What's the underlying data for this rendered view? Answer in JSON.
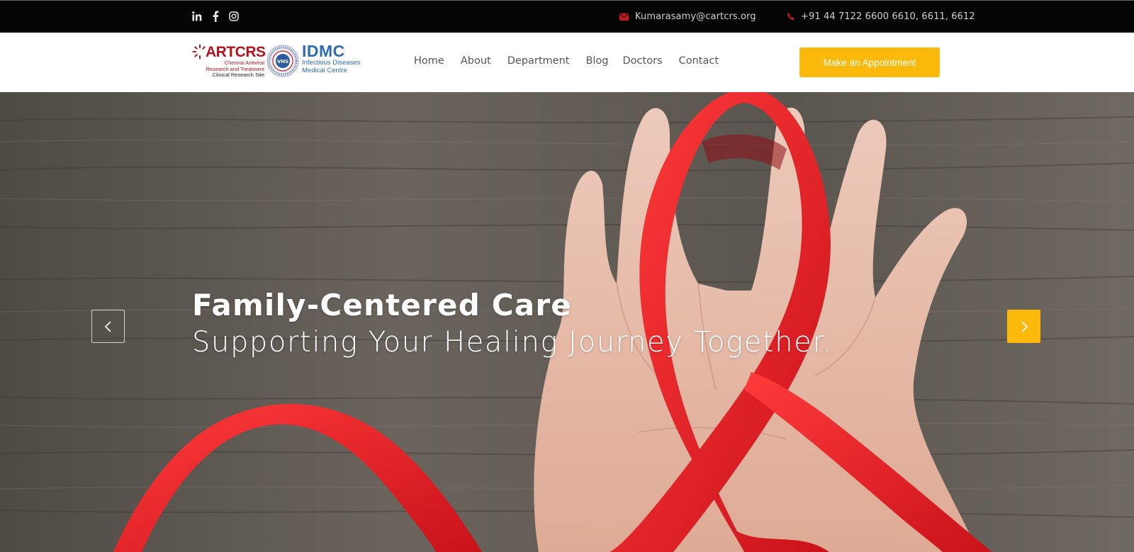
{
  "topbar": {
    "social": [
      {
        "icon": "linkedin-icon"
      },
      {
        "icon": "facebook-icon"
      },
      {
        "icon": "instagram-icon"
      }
    ],
    "email": "Kumarasamy@cartcrs.org",
    "phone": "+91 44 7122 6600 6610, 6611, 6612",
    "icon_color": "#c8161d"
  },
  "logo": {
    "artcrs_text": "ARTCRS",
    "artcrs_line1": "Chennai Antiviral",
    "artcrs_line2": "Research and Treatment",
    "artcrs_line3": "Clinical Research Site",
    "seal_text": "VHS",
    "idmc_text": "IDMC",
    "idmc_line1": "Infectious Diseases",
    "idmc_line2": "Medical Centre"
  },
  "nav": {
    "items": [
      "Home",
      "About",
      "Department",
      "Blog",
      "Doctors",
      "Contact"
    ]
  },
  "cta": {
    "label": "Make an Appointment",
    "color": "#fbb90c"
  },
  "hero": {
    "title": "Family-Centered Care",
    "subtitle": "Supporting Your Healing Journey Together.",
    "prev_icon": "chevron-left-icon",
    "next_icon": "chevron-right-icon"
  }
}
